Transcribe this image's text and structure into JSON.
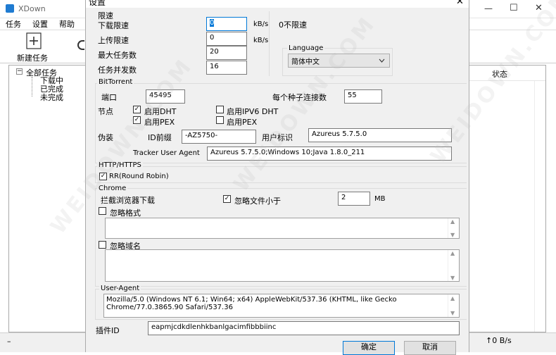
{
  "main_window": {
    "title": "XDown",
    "menu": [
      "任务",
      "设置",
      "帮助"
    ],
    "toolbar": {
      "new_task_label": "新建任务"
    },
    "tree": {
      "root": "全部任务",
      "children": [
        "下载中",
        "已完成",
        "未完成"
      ]
    },
    "list": {
      "status_header": "状态"
    },
    "statusbar": {
      "speed": "↑0 B/s",
      "left_char": "–"
    },
    "caption_buttons": {
      "minimize": "—",
      "maximize": "☐",
      "close": "✕"
    }
  },
  "dialog": {
    "title": "设置",
    "close_glyph": "✕",
    "speed_limit": {
      "group_label": "限速",
      "download_label": "下载限速",
      "download_value": "0",
      "upload_label": "上传限速",
      "upload_value": "0",
      "unit_kb": "kB/s",
      "max_tasks_label": "最大任务数",
      "max_tasks_value": "20",
      "concurrency_label": "任务并发数",
      "concurrency_value": "16",
      "no_limit_note": "0不限速"
    },
    "language": {
      "group_label": "Language",
      "selected": "简体中文"
    },
    "bittorrent": {
      "group_label": "BitTorrent",
      "port_label": "端口",
      "port_value": "45495",
      "conn_label": "每个种子连接数",
      "conn_value": "55",
      "nodes_label": "节点",
      "dht_label": "启用DHT",
      "dht_checked": true,
      "ipv6dht_label": "启用IPV6 DHT",
      "ipv6dht_checked": false,
      "pex_label": "启用PEX",
      "pex_checked": true,
      "pex2_label": "启用PEX",
      "pex2_checked": false,
      "disguise_label": "伪装",
      "id_prefix_label": "ID前缀",
      "id_prefix_value": "-AZ5750-",
      "user_id_label": "用户标识",
      "user_id_value": "Azureus 5.7.5.0",
      "tracker_ua_label": "Tracker User Agent",
      "tracker_ua_value": "Azureus 5.7.5.0;Windows 10;Java 1.8.0_211"
    },
    "http": {
      "group_label": "HTTP/HTTPS",
      "rr_label": "RR(Round Robin)",
      "rr_checked": true
    },
    "chrome": {
      "group_label": "Chrome",
      "intercept_label": "拦截浏览器下载",
      "ignore_small_label": "忽略文件小于",
      "ignore_small_checked": true,
      "ignore_small_value": "2",
      "ignore_small_unit": "MB",
      "ignore_format_label": "忽略格式",
      "ignore_format_checked": false,
      "ignore_domain_label": "忽略域名",
      "ignore_domain_checked": false
    },
    "user_agent": {
      "group_label": "User-Agent",
      "line1": "Mozilla/5.0 (Windows NT 6.1; Win64; x64) AppleWebKit/537.36 (KHTML, like Gecko",
      "line2": "Chrome/77.0.3865.90 Safari/537.36"
    },
    "plugin": {
      "label": "插件ID",
      "value": "eapmjcdkdlenhkbanlgacimfibbbiinc"
    },
    "ok_label": "确定",
    "cancel_label": "取消"
  },
  "watermark": "WEIDOWN.COM",
  "colors": {
    "dialog_bg": "#f0f0f0",
    "selection": "#0078d7",
    "input_border": "#7a7a7a"
  }
}
